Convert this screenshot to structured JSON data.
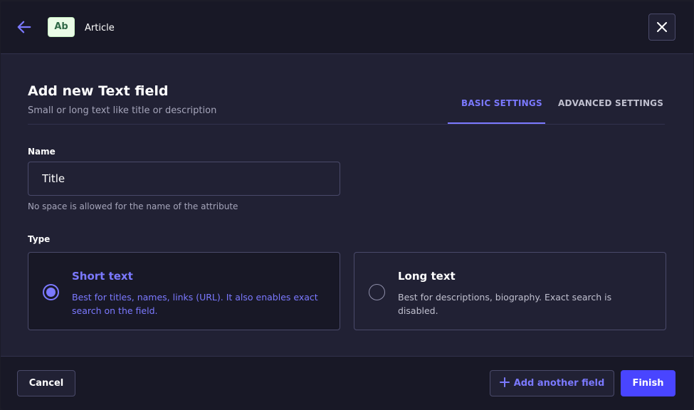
{
  "header": {
    "back_icon": "arrow-left-icon",
    "badge": "Ab",
    "breadcrumb": "Article",
    "close_icon": "close-icon"
  },
  "form": {
    "title": "Add new Text field",
    "subtitle": "Small or long text like title or description",
    "tabs": [
      {
        "label": "BASIC SETTINGS",
        "active": true
      },
      {
        "label": "ADVANCED SETTINGS",
        "active": false
      }
    ],
    "name_label": "Name",
    "name_value": "Title",
    "name_hint": "No space is allowed for the name of the attribute",
    "type_label": "Type",
    "types": [
      {
        "title": "Short text",
        "description": "Best for titles, names, links (URL). It also enables exact search on the field.",
        "selected": true
      },
      {
        "title": "Long text",
        "description": "Best for descriptions, biography. Exact search is disabled.",
        "selected": false
      }
    ]
  },
  "footer": {
    "cancel": "Cancel",
    "add_another": "Add another field",
    "add_icon": "plus-icon",
    "finish": "Finish"
  },
  "colors": {
    "accent": "#7b79ff",
    "primary_button": "#4945ff",
    "badge_bg": "#eafbe7"
  }
}
